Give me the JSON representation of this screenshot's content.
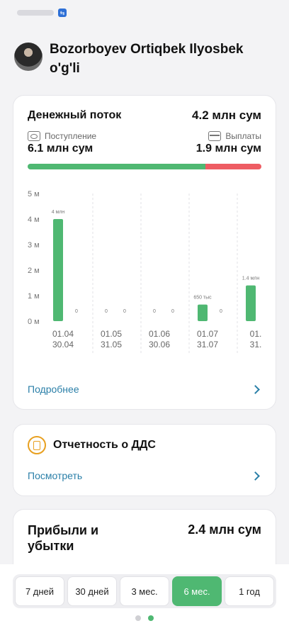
{
  "statusbar": {
    "app_badge": "⇆"
  },
  "profile": {
    "name": "Bozorboyev Ortiqbek Ilyosbek o'g'li"
  },
  "cash_flow": {
    "title": "Денежный поток",
    "total": "4.2 млн сум",
    "income_label": "Поступление",
    "income_value": "6.1 млн сум",
    "outcome_label": "Выплаты",
    "outcome_value": "1.9 млн сум",
    "income_share": 0.76,
    "link_label": "Подробнее",
    "colors": {
      "income": "#4fb872",
      "outcome": "#ee5c63"
    }
  },
  "chart_data": {
    "type": "bar",
    "y_ticks": [
      "5 м",
      "4 м",
      "3 м",
      "2 м",
      "1 м",
      "0 м"
    ],
    "ylim": [
      0,
      5000000
    ],
    "categories": [
      {
        "line1": "01.04",
        "line2": "30.04"
      },
      {
        "line1": "01.05",
        "line2": "31.05"
      },
      {
        "line1": "01.06",
        "line2": "30.06"
      },
      {
        "line1": "01.07",
        "line2": "31.07"
      },
      {
        "line1": "01.",
        "line2": "31."
      }
    ],
    "series": [
      {
        "values": [
          4000000,
          0,
          0,
          650000,
          1400000
        ],
        "labels": [
          "4 млн",
          "0",
          "0",
          "650 тыс",
          "1.4 млн"
        ],
        "color": "#4fb872"
      },
      {
        "values": [
          0,
          0,
          0,
          0,
          0
        ],
        "labels": [
          "0",
          "0",
          "0",
          "0",
          ""
        ],
        "color": "#ee5c63"
      }
    ]
  },
  "dds": {
    "title": "Отчетность о ДДС",
    "link_label": "Посмотреть",
    "icon_color": "#e8a020"
  },
  "pnl": {
    "title": "Прибыли и убытки",
    "value": "2.4 млн сум"
  },
  "periods": {
    "items": [
      "7 дней",
      "30 дней",
      "3 мес.",
      "6 мес.",
      "1 год"
    ],
    "active_index": 3
  },
  "pager": {
    "count": 2,
    "active": 1
  }
}
